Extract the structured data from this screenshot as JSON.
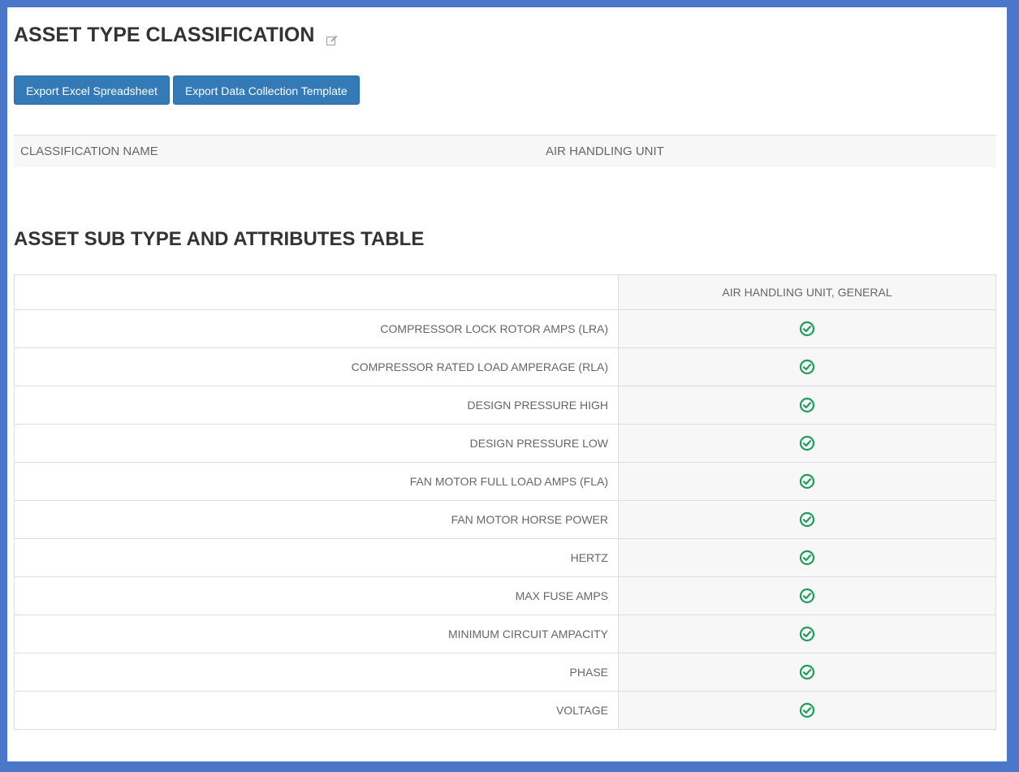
{
  "header": {
    "title": "ASSET TYPE CLASSIFICATION",
    "edit_icon": "edit-icon"
  },
  "toolbar": {
    "export_excel_label": "Export Excel Spreadsheet",
    "export_template_label": "Export Data Collection Template"
  },
  "classification": {
    "label": "CLASSIFICATION NAME",
    "value": "AIR HANDLING UNIT"
  },
  "attributes_section": {
    "title": "ASSET SUB TYPE AND ATTRIBUTES TABLE",
    "column_header": "AIR HANDLING UNIT, GENERAL",
    "check_icon": "check-circle-icon",
    "check_color": "#1e9e5c",
    "rows": [
      "COMPRESSOR LOCK ROTOR AMPS (LRA)",
      "COMPRESSOR RATED LOAD AMPERAGE (RLA)",
      "DESIGN PRESSURE HIGH",
      "DESIGN PRESSURE LOW",
      "FAN MOTOR FULL LOAD AMPS (FLA)",
      "FAN MOTOR HORSE POWER",
      "HERTZ",
      "MAX FUSE AMPS",
      "MINIMUM CIRCUIT AMPACITY",
      "PHASE",
      "VOLTAGE"
    ]
  },
  "colors": {
    "frame_border": "#4a77c9",
    "button_bg": "#337ab7"
  }
}
